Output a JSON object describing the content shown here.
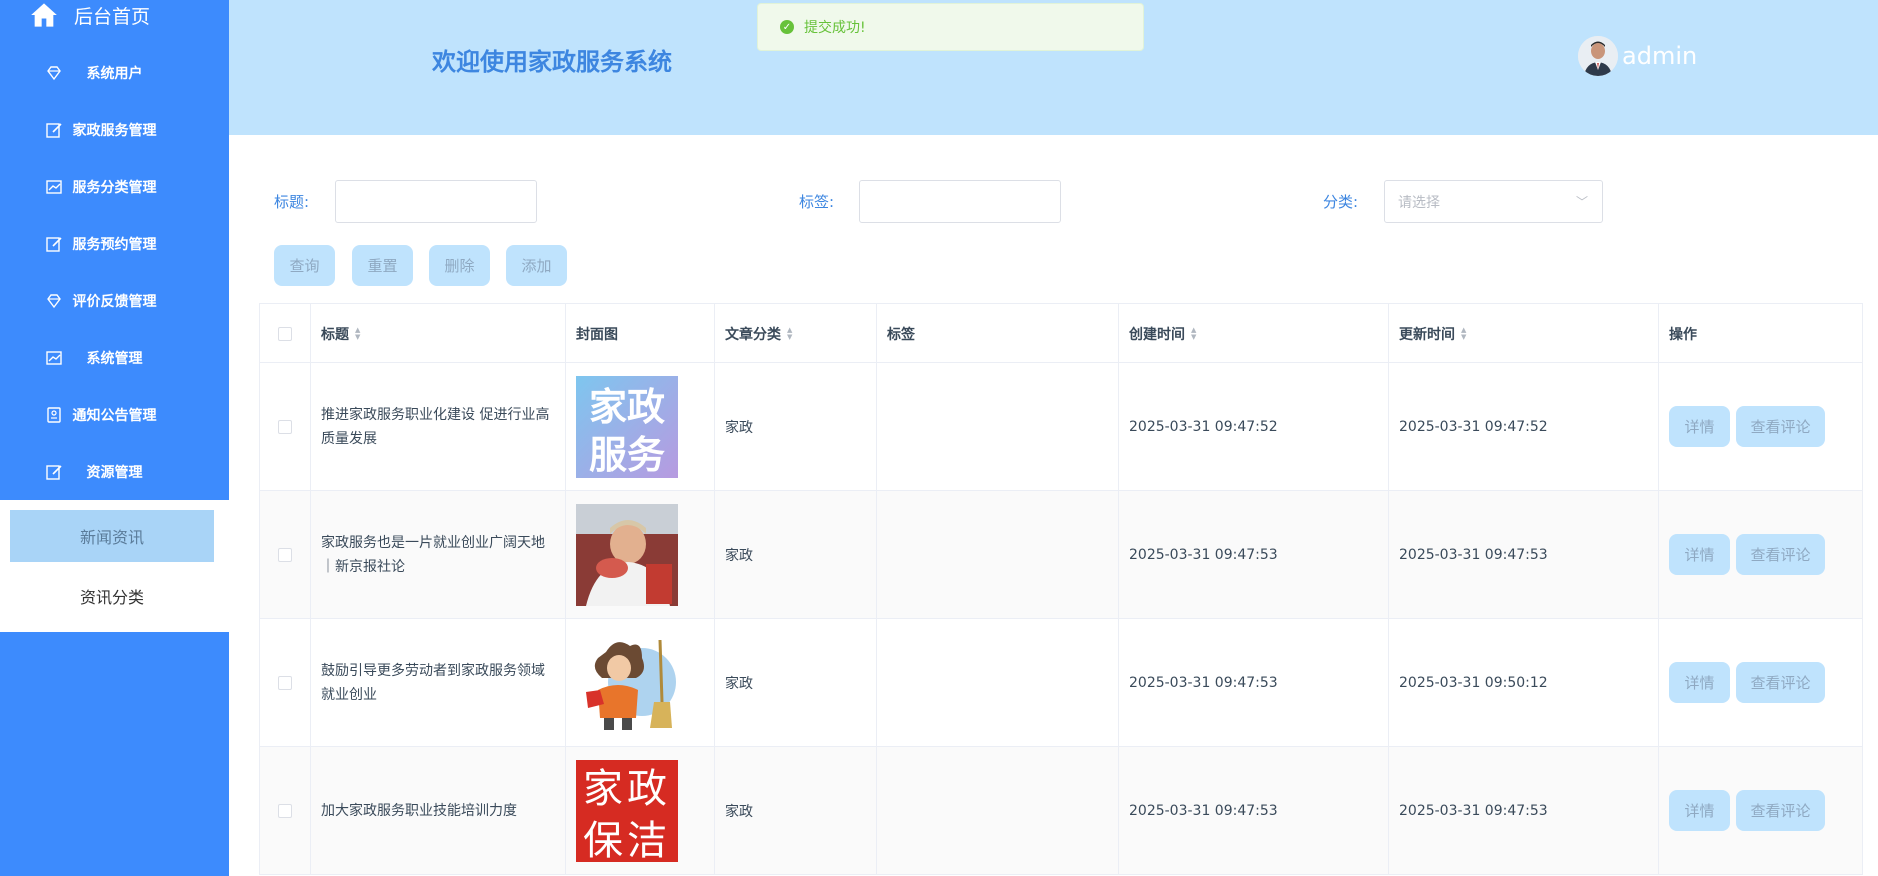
{
  "sidebar": {
    "home_label": "后台首页",
    "items": [
      {
        "label": "系统用户",
        "icon": "gem-icon"
      },
      {
        "label": "家政服务管理",
        "icon": "edit-icon"
      },
      {
        "label": "服务分类管理",
        "icon": "chart-icon"
      },
      {
        "label": "服务预约管理",
        "icon": "edit-icon"
      },
      {
        "label": "评价反馈管理",
        "icon": "gem-icon"
      },
      {
        "label": "系统管理",
        "icon": "chart-icon"
      },
      {
        "label": "通知公告管理",
        "icon": "notice-icon"
      },
      {
        "label": "资源管理",
        "icon": "edit-icon"
      }
    ],
    "submenu": [
      {
        "label": "新闻资讯"
      },
      {
        "label": "资讯分类"
      }
    ]
  },
  "header": {
    "welcome": "欢迎使用家政服务系统",
    "username": "admin",
    "toast": "提交成功!"
  },
  "search": {
    "title_label": "标题:",
    "tag_label": "标签:",
    "category_label": "分类:",
    "category_placeholder": "请选择"
  },
  "toolbar": {
    "query": "查询",
    "reset": "重置",
    "delete": "删除",
    "add": "添加"
  },
  "table": {
    "columns": [
      "标题",
      "封面图",
      "文章分类",
      "标签",
      "创建时间",
      "更新时间",
      "操作"
    ],
    "rows": [
      {
        "title": "推进家政服务职业化建设 促进行业高质量发展",
        "cover": "家政服务",
        "category": "家政",
        "tag": "",
        "created": "2025-03-31 09:47:52",
        "updated": "2025-03-31 09:47:52"
      },
      {
        "title": "家政服务也是一片就业创业广阔天地｜新京报社论",
        "cover": "photo",
        "category": "家政",
        "tag": "",
        "created": "2025-03-31 09:47:53",
        "updated": "2025-03-31 09:47:53"
      },
      {
        "title": "鼓励引导更多劳动者到家政服务领域就业创业",
        "cover": "cartoon",
        "category": "家政",
        "tag": "",
        "created": "2025-03-31 09:47:53",
        "updated": "2025-03-31 09:50:12"
      },
      {
        "title": "加大家政服务职业技能培训力度",
        "cover": "家政保洁",
        "category": "家政",
        "tag": "",
        "created": "2025-03-31 09:47:53",
        "updated": "2025-03-31 09:47:53"
      }
    ],
    "action_detail": "详情",
    "action_comments": "查看评论"
  },
  "colors": {
    "sidebar": "#3d8bfd",
    "header": "#bfe3fd",
    "accent": "#3d86e0",
    "success": "#67c23a"
  }
}
